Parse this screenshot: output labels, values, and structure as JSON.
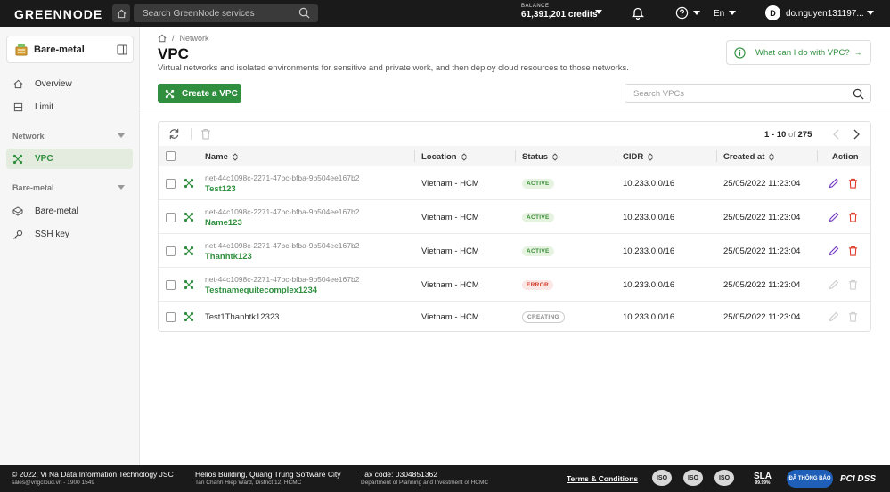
{
  "topbar": {
    "logo": "GREENNODE",
    "search_placeholder": "Search GreenNode services",
    "balance_label": "BALANCE",
    "balance_value": "61,391,201 credits",
    "language": "En",
    "avatar_initial": "D",
    "username": "do.nguyen131197..."
  },
  "sidebar": {
    "product": "Bare-metal",
    "items_top": [
      {
        "label": "Overview",
        "icon": "home-icon"
      },
      {
        "label": "Limit",
        "icon": "limit-icon"
      }
    ],
    "section_network": "Network",
    "network_items": [
      {
        "label": "VPC",
        "icon": "vpc-icon",
        "active": true
      }
    ],
    "section_baremetal": "Bare-metal",
    "baremetal_items": [
      {
        "label": "Bare-metal",
        "icon": "server-icon"
      },
      {
        "label": "SSH key",
        "icon": "key-icon"
      }
    ]
  },
  "page": {
    "breadcrumb": "Network",
    "title": "VPC",
    "description": "Virtual networks and isolated environments for sensitive and private work, and then deploy cloud resources to those networks.",
    "help_link": "What can I do with VPC?",
    "create_button": "Create a VPC",
    "search_placeholder": "Search VPCs"
  },
  "table": {
    "pagination": {
      "range": "1 - 10",
      "of": "of",
      "total": "275"
    },
    "columns": [
      "Name",
      "Location",
      "Status",
      "CIDR",
      "Created at",
      "Action"
    ],
    "rows": [
      {
        "id": "net-44c1098c-2271-47bc-bfba-9b504ee167b2",
        "name": "Test123",
        "location": "Vietnam - HCM",
        "status": "ACTIVE",
        "status_kind": "active",
        "cidr": "10.233.0.0/16",
        "created": "25/05/2022 11:23:04"
      },
      {
        "id": "net-44c1098c-2271-47bc-bfba-9b504ee167b2",
        "name": "Name123",
        "location": "Vietnam - HCM",
        "status": "ACTIVE",
        "status_kind": "active",
        "cidr": "10.233.0.0/16",
        "created": "25/05/2022 11:23:04"
      },
      {
        "id": "net-44c1098c-2271-47bc-bfba-9b504ee167b2",
        "name": "Thanhtk123",
        "location": "Vietnam - HCM",
        "status": "ACTIVE",
        "status_kind": "active",
        "cidr": "10.233.0.0/16",
        "created": "25/05/2022 11:23:04"
      },
      {
        "id": "net-44c1098c-2271-47bc-bfba-9b504ee167b2",
        "name": "Testnamequitecomplex1234",
        "location": "Vietnam - HCM",
        "status": "ERROR",
        "status_kind": "error",
        "cidr": "10.233.0.0/16",
        "created": "25/05/2022 11:23:04"
      },
      {
        "id": "",
        "name": "Test1Thanhtk12323",
        "location": "Vietnam - HCM",
        "status": "CREATING",
        "status_kind": "creating",
        "cidr": "10.233.0.0/16",
        "created": "25/05/2022 11:23:04"
      }
    ]
  },
  "footer": {
    "company": "© 2022, Vi Na Data Information Technology JSC",
    "contact": "sales@vngcloud.vn - 1900 1549",
    "address1": "Helios Building, Quang Trung Software City",
    "address2": "Tan Chanh Hiep Ward, District 12, HCMC",
    "tax": "Tax code: 0304851362",
    "tax_dept": "Department of Planning and Investment of HCMC",
    "terms": "Terms & Conditions",
    "certs": [
      "ISO",
      "ISO",
      "ISO"
    ],
    "sla": "SLA",
    "sla_value": "99.99%",
    "dv": "ĐÃ THÔNG BÁO",
    "pci": "PCI DSS"
  },
  "colors": {
    "brand": "#2f8f3e",
    "topbar": "#1a1a1a",
    "error": "#d43c2c",
    "edit": "#7b3fc4"
  }
}
